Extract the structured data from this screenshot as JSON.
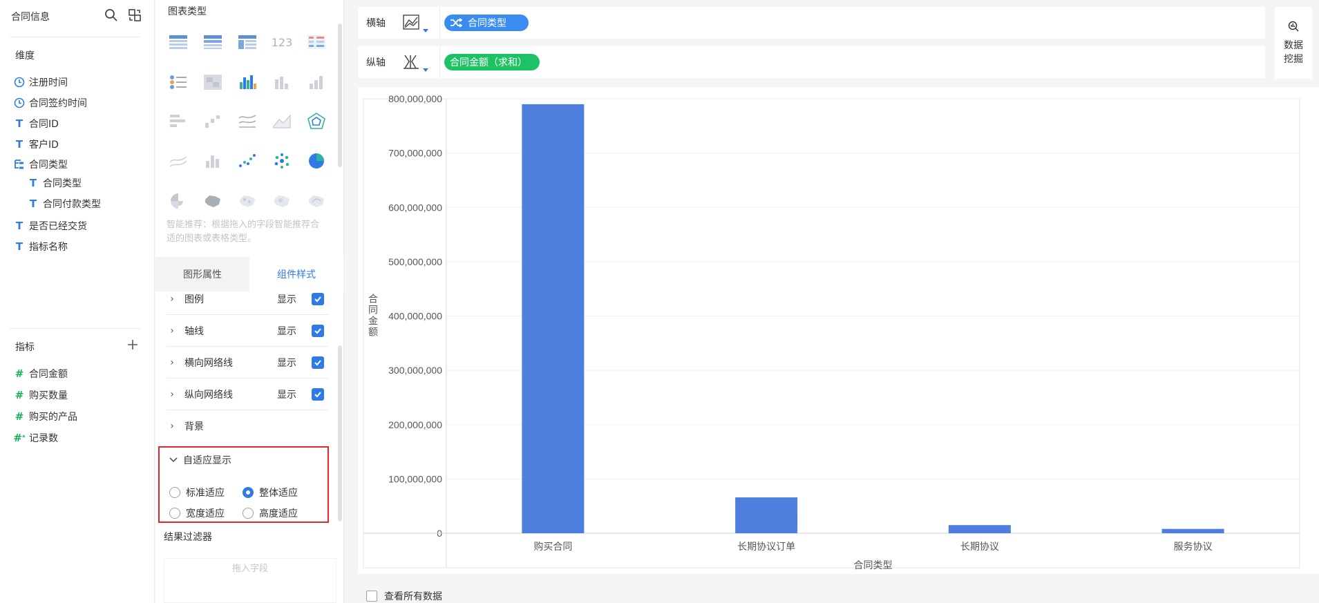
{
  "left_panel": {
    "title": "合同信息",
    "dimensions_title": "维度",
    "dimensions": [
      {
        "label": "注册时间",
        "icon": "clock-icon"
      },
      {
        "label": "合同签约时间",
        "icon": "clock-icon"
      },
      {
        "label": "合同ID",
        "icon": "text-type-icon"
      },
      {
        "label": "客户ID",
        "icon": "text-type-icon"
      },
      {
        "label": "合同类型",
        "icon": "hierarchy-icon"
      },
      {
        "label": "合同类型",
        "icon": "text-type-icon"
      },
      {
        "label": "合同付款类型",
        "icon": "text-type-icon"
      },
      {
        "label": "是否已经交货",
        "icon": "text-type-icon"
      },
      {
        "label": "指标名称",
        "icon": "text-type-icon"
      }
    ],
    "measures_title": "指标",
    "measures": [
      {
        "label": "合同金额",
        "icon": "number-type-icon"
      },
      {
        "label": "购买数量",
        "icon": "number-type-icon"
      },
      {
        "label": "购买的产品",
        "icon": "number-type-icon"
      },
      {
        "label": "记录数",
        "icon": "record-count-icon"
      }
    ]
  },
  "chart_panel": {
    "title": "图表类型",
    "hint": "智能推荐：根据拖入的字段智能推荐合适的图表或表格类型。",
    "tabs": [
      "图形属性",
      "组件样式"
    ],
    "active_tab": "组件样式",
    "properties": [
      {
        "label": "图例",
        "show": "显示",
        "checked": true
      },
      {
        "label": "轴线",
        "show": "显示",
        "checked": true
      },
      {
        "label": "横向网络线",
        "show": "显示",
        "checked": true
      },
      {
        "label": "纵向网络线",
        "show": "显示",
        "checked": true
      },
      {
        "label": "背景"
      }
    ],
    "adaptive": {
      "title": "自适应显示",
      "options": [
        "标准适应",
        "整体适应",
        "宽度适应",
        "高度适应"
      ],
      "selected": "整体适应"
    },
    "filter_title": "结果过滤器",
    "filter_placeholder": "拖入字段"
  },
  "x_axis_bar": {
    "label": "横轴",
    "field": "合同类型",
    "color": "#3b8cf0"
  },
  "y_axis_bar": {
    "label": "纵轴",
    "field": "合同金额（求和）",
    "color": "#1cc263"
  },
  "data_mining": {
    "label_line1": "数据",
    "label_line2": "挖掘"
  },
  "view_all_label": "查看所有数据",
  "colors": {
    "accent": "#2e7be8",
    "bar": "#4e7fdf",
    "highlight_border": "#e02828"
  },
  "chart_data": {
    "type": "bar",
    "categories": [
      "购买合同",
      "长期协议订单",
      "长期协议",
      "服务协议"
    ],
    "values": [
      790000000,
      66000000,
      15000000,
      8000000
    ],
    "xlabel": "合同类型",
    "ylabel": "合同金额",
    "ylim": [
      0,
      800000000
    ],
    "yticks": [
      0,
      100000000,
      200000000,
      300000000,
      400000000,
      500000000,
      600000000,
      700000000,
      800000000
    ],
    "ytick_labels": [
      "0",
      "100,000,000",
      "200,000,000",
      "300,000,000",
      "400,000,000",
      "500,000,000",
      "600,000,000",
      "700,000,000",
      "800,000,000"
    ],
    "grid": true,
    "legend": "none"
  }
}
